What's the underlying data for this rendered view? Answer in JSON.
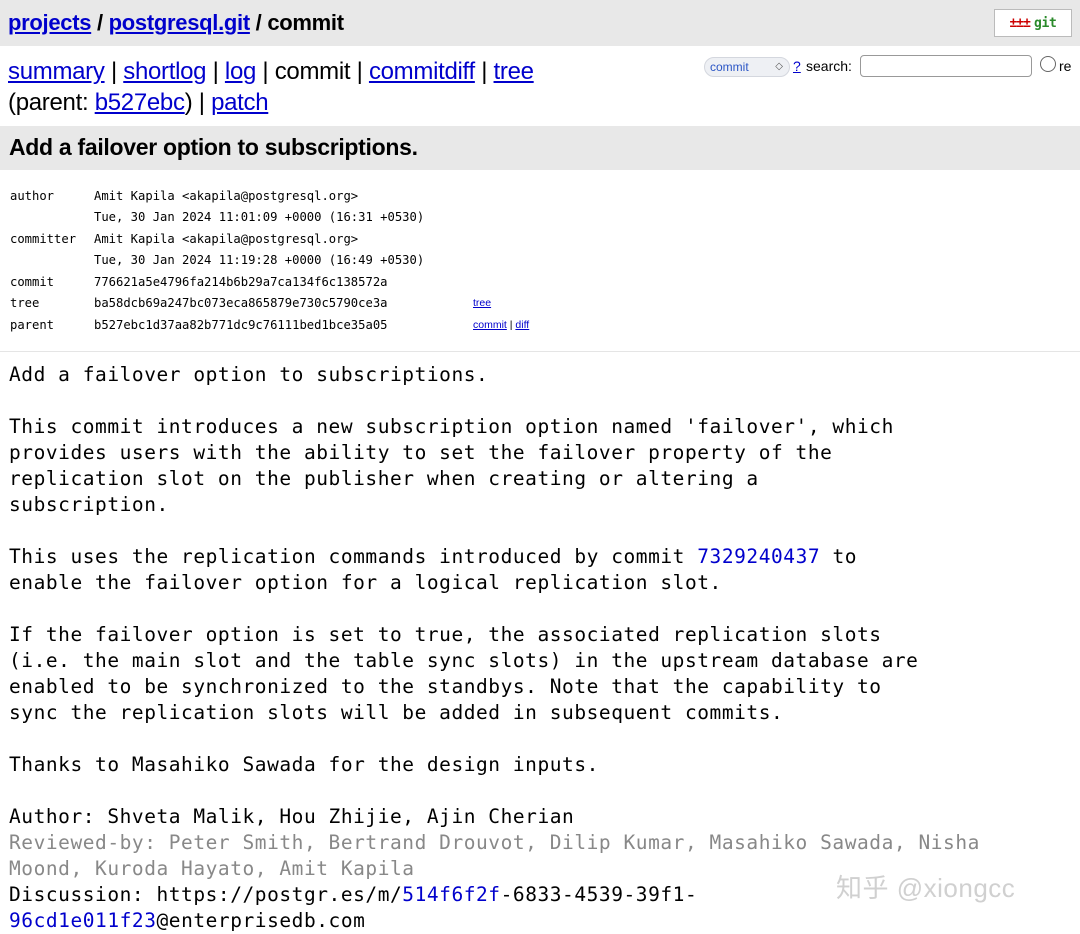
{
  "header": {
    "crumb_projects": "projects",
    "crumb_sep1": " / ",
    "crumb_repo": "postgresql.git",
    "crumb_sep2": " / ",
    "crumb_page": "commit",
    "logo_text": "git",
    "logo_icon": "git-logo-icon"
  },
  "nav": {
    "summary": "summary",
    "shortlog": "shortlog",
    "log": "log",
    "commit": "commit",
    "commitdiff": "commitdiff",
    "tree": "tree",
    "sep": " | ",
    "parent_prefix": "(parent: ",
    "parent_hash": "b527ebc",
    "parent_suffix": ") | ",
    "patch": "patch"
  },
  "search": {
    "type_selected": "commit",
    "help": "?",
    "label": "search:",
    "value": "",
    "regex_label": "re"
  },
  "commit_title": "Add a failover option to subscriptions.",
  "meta": {
    "author_label": "author",
    "author": "Amit Kapila <akapila@postgresql.org>",
    "author_date": "Tue, 30 Jan 2024 11:01:09 +0000 (16:31 +0530)",
    "committer_label": "committer",
    "committer": "Amit Kapila <akapila@postgresql.org>",
    "committer_date": "Tue, 30 Jan 2024 11:19:28 +0000 (16:49 +0530)",
    "commit_label": "commit",
    "commit_hash": "776621a5e4796fa214b6b29a7ca134f6c138572a",
    "tree_label": "tree",
    "tree_hash": "ba58dcb69a247bc073eca865879e730c5790ce3a",
    "tree_link": "tree",
    "parent_label": "parent",
    "parent_hash": "b527ebc1d37aa82b771dc9c76111bed1bce35a05",
    "parent_commit_link": "commit",
    "parent_sep": " | ",
    "parent_diff_link": "diff"
  },
  "message": {
    "line1": "Add a failover option to subscriptions.",
    "para1": "This commit introduces a new subscription option named 'failover', which\nprovides users with the ability to set the failover property of the\nreplication slot on the publisher when creating or altering a\nsubscription.",
    "para2_before": "This uses the replication commands introduced by commit ",
    "para2_hash": "7329240437",
    "para2_after": " to\nenable the failover option for a logical replication slot.",
    "para3": "If the failover option is set to true, the associated replication slots\n(i.e. the main slot and the table sync slots) in the upstream database are\nenabled to be synchronized to the standbys. Note that the capability to\nsync the replication slots will be added in subsequent commits.",
    "para4": "Thanks to Masahiko Sawada for the design inputs.",
    "author_line": "Author: Shveta Malik, Hou Zhijie, Ajin Cherian",
    "reviewed_line": "Reviewed-by: Peter Smith, Bertrand Drouvot, Dilip Kumar, Masahiko Sawada, Nisha\nMoond, Kuroda Hayato, Amit Kapila",
    "discussion_prefix": "Discussion: https://postgr.es/m/",
    "discussion_hash1": "514f6f2f",
    "discussion_mid": "-6833-4539-39f1-\n",
    "discussion_hash2": "96cd1e011f23",
    "discussion_suffix": "@enterprisedb.com"
  },
  "watermark": "知乎 @xiongcc"
}
